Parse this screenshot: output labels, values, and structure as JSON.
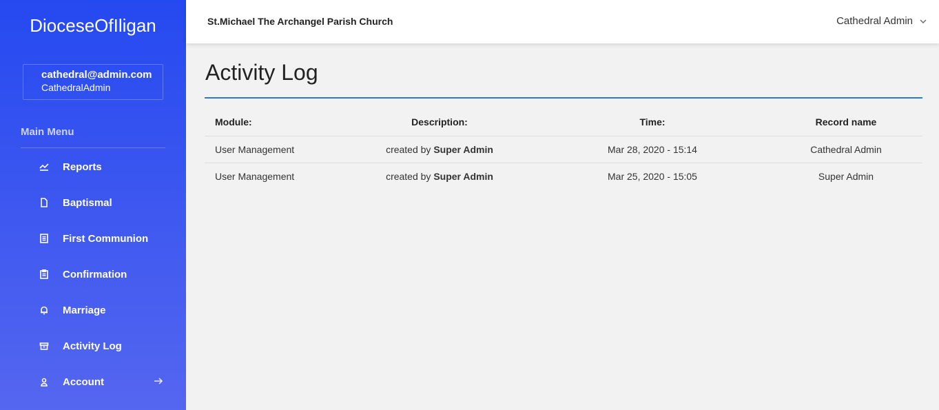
{
  "sidebar": {
    "brand": "DioceseOfIligan",
    "user": {
      "email": "cathedral@admin.com",
      "role": "CathedralAdmin"
    },
    "menu_title": "Main Menu",
    "items": [
      {
        "label": "Reports",
        "icon": "chart-line-icon"
      },
      {
        "label": "Baptismal",
        "icon": "file-icon"
      },
      {
        "label": "First Communion",
        "icon": "document-list-icon"
      },
      {
        "label": "Confirmation",
        "icon": "clipboard-icon"
      },
      {
        "label": "Marriage",
        "icon": "bell-icon"
      },
      {
        "label": "Activity Log",
        "icon": "archive-icon"
      },
      {
        "label": "Account",
        "icon": "user-icon"
      }
    ]
  },
  "header": {
    "parish": "St.Michael The Archangel Parish Church",
    "admin_name": "Cathedral Admin"
  },
  "main": {
    "title": "Activity Log",
    "columns": [
      "Module:",
      "Description:",
      "Time:",
      "Record name"
    ],
    "rows": [
      {
        "module": "User Management",
        "desc_prefix": "created by",
        "desc_actor": "Super Admin",
        "time": "Mar 28, 2020 - 15:14",
        "record": "Cathedral Admin"
      },
      {
        "module": "User Management",
        "desc_prefix": "created by",
        "desc_actor": "Super Admin",
        "time": "Mar 25, 2020 - 15:05",
        "record": "Super Admin"
      }
    ]
  },
  "colors": {
    "sidebar_top": "#2549f0",
    "sidebar_bottom": "#5566f0",
    "accent_rule": "#2a77d6"
  }
}
